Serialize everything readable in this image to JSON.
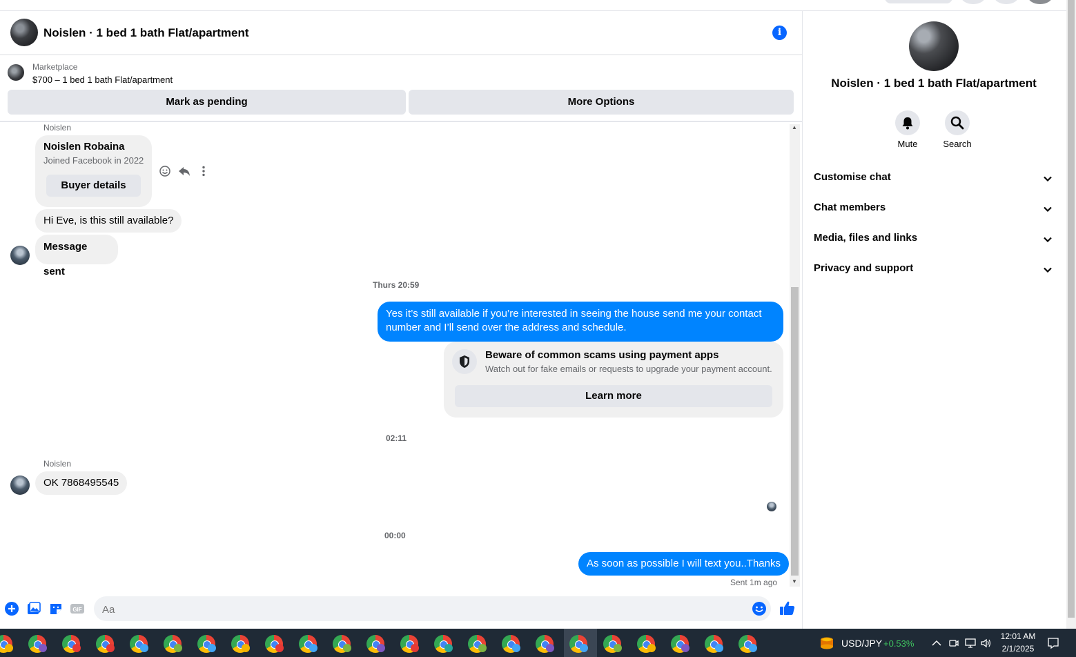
{
  "header": {
    "title": "Noislen · 1 bed 1 bath Flat/apartment",
    "info_icon": "info-icon"
  },
  "marketplace": {
    "label": "Marketplace",
    "listing": "$700 – 1 bed 1 bath Flat/apartment",
    "mark_pending": "Mark as pending",
    "more_options": "More Options"
  },
  "chat": {
    "sender_name": "Noislen",
    "buyer_card": {
      "name": "Noislen Robaina",
      "joined": "Joined Facebook in 2022",
      "button": "Buyer details"
    },
    "messages": [
      {
        "from": "Noislen",
        "text": "Hi Eve, is this still available?"
      },
      {
        "from": "Noislen",
        "text": "Message sent"
      },
      {
        "from": "me",
        "text": "Yes it’s still available if you’re interested in seeing the house send me your contact number and I’ll send over the address and schedule."
      },
      {
        "from": "Noislen",
        "text": "OK 7868495545"
      },
      {
        "from": "me",
        "text": "As soon as possible I will text you..Thanks"
      }
    ],
    "timestamps": [
      "Thurs 20:59",
      "02:11",
      "00:00"
    ],
    "second_sender_name": "Noislen",
    "warning": {
      "title": "Beware of common scams using payment apps",
      "subtitle": "Watch out for fake emails or requests to upgrade your payment account.",
      "button": "Learn more"
    },
    "sent_status": "Sent 1m ago"
  },
  "composer": {
    "placeholder": "Aa"
  },
  "right_panel": {
    "title": "Noislen · 1 bed 1 bath Flat/apartment",
    "actions": [
      {
        "label": "Mute",
        "icon": "bell-icon"
      },
      {
        "label": "Search",
        "icon": "search-icon"
      }
    ],
    "sections": [
      "Customise chat",
      "Chat members",
      "Media, files and links",
      "Privacy and support"
    ]
  },
  "taskbar": {
    "ticker": "USD/JPY",
    "ticker_change": "+0.53%",
    "time": "12:01 AM",
    "date": "2/1/2025"
  },
  "colors": {
    "accent": "#0084ff",
    "fb_blue": "#0866ff",
    "positive": "#3fc35f"
  }
}
